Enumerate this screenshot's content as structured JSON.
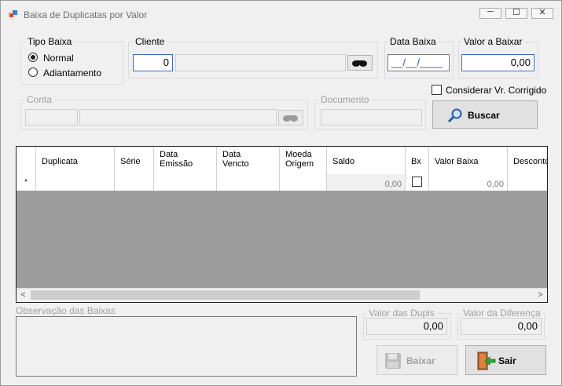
{
  "window": {
    "title": "Baixa de Duplicatas por Valor",
    "minimize_glyph": "─",
    "maximize_glyph": "☐",
    "close_glyph": "✕"
  },
  "tipo_baixa": {
    "label": "Tipo Baixa",
    "options": [
      {
        "label": "Normal",
        "selected": true
      },
      {
        "label": "Adiantamento",
        "selected": false
      }
    ]
  },
  "cliente": {
    "label": "Cliente",
    "code": "0",
    "name": ""
  },
  "data_baixa": {
    "label": "Data Baixa",
    "value": "__/__/____"
  },
  "valor_baixar": {
    "label": "Valor a Baixar",
    "value": "0,00"
  },
  "considerar": {
    "label": "Considerar Vr. Corrigido",
    "checked": false
  },
  "conta": {
    "label": "Conta",
    "code": "",
    "name": ""
  },
  "documento": {
    "label": "Documento",
    "value": ""
  },
  "buscar": {
    "label": "Buscar",
    "icon": "magnifier-icon"
  },
  "grid": {
    "columns": [
      "Duplicata",
      "Série",
      "Data\nEmissão",
      "Data\nVencto",
      "Moeda\nOrigem",
      "Saldo",
      "Bx",
      "Valor Baixa",
      "Desconto"
    ],
    "new_row_marker": "*",
    "row": {
      "saldo": "0,00",
      "bx": false,
      "valor_baixa": "0,00"
    }
  },
  "observacao": {
    "label": "Observação das Baixas",
    "value": ""
  },
  "valor_dupls": {
    "label": "Valor das Dupls",
    "value": "0,00"
  },
  "valor_diferenca": {
    "label": "Valor da Diferença",
    "value": "0,00"
  },
  "baixar": {
    "label": "Baixar",
    "icon": "floppy-disk-icon",
    "enabled": false
  },
  "sair": {
    "label": "Sair",
    "icon": "exit-door-icon",
    "enabled": true
  },
  "colors": {
    "accent": "#3d6cc6",
    "disabled_text": "#a0a0a0",
    "grid_bg": "#9d9d9d"
  }
}
